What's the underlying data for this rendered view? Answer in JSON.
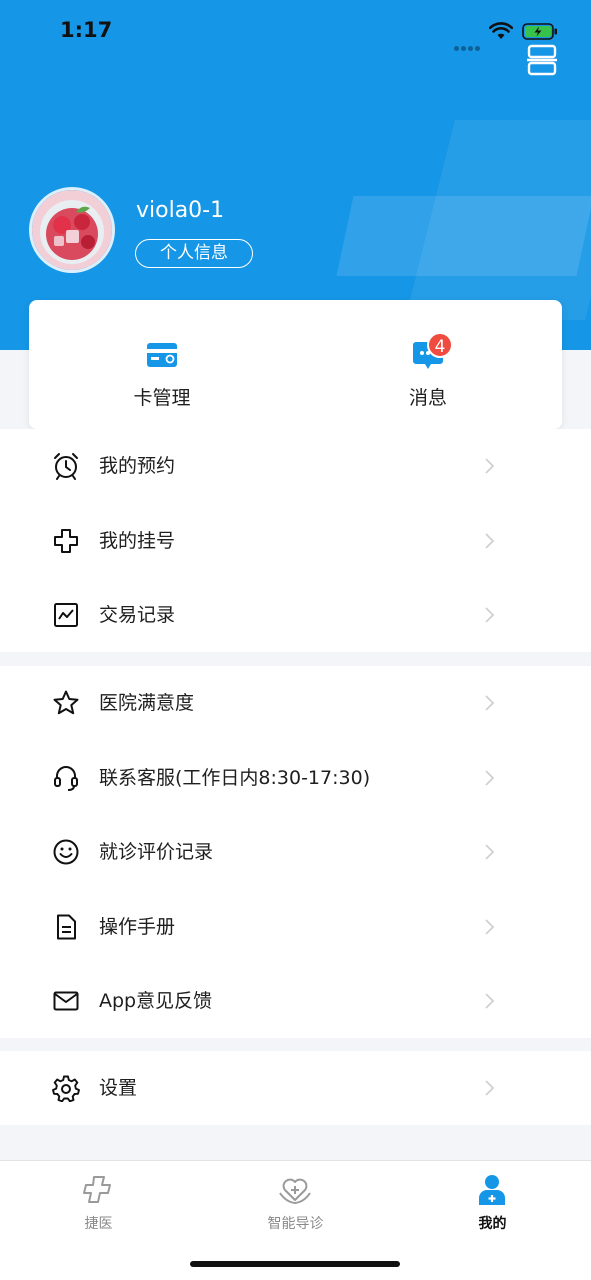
{
  "status_bar": {
    "time": "1:17"
  },
  "profile": {
    "username": "viola0-1",
    "info_button": "个人信息"
  },
  "quick_actions": [
    {
      "label": "卡管理",
      "icon": "card-icon"
    },
    {
      "label": "消息",
      "icon": "message-icon",
      "badge": "4"
    }
  ],
  "menu_group_1": [
    {
      "label": "我的预约",
      "icon": "alarm-clock-icon"
    },
    {
      "label": "我的挂号",
      "icon": "medical-cross-icon"
    },
    {
      "label": "交易记录",
      "icon": "chart-icon"
    }
  ],
  "menu_group_2": [
    {
      "label": "医院满意度",
      "icon": "star-icon"
    },
    {
      "label": "联系客服(工作日内8:30-17:30)",
      "icon": "headset-icon"
    },
    {
      "label": "就诊评价记录",
      "icon": "smiley-icon"
    },
    {
      "label": "操作手册",
      "icon": "document-icon"
    },
    {
      "label": "App意见反馈",
      "icon": "mail-icon"
    }
  ],
  "menu_group_3": [
    {
      "label": "设置",
      "icon": "gear-icon"
    }
  ],
  "tab_bar": [
    {
      "label": "捷医",
      "icon": "cross-outline-icon",
      "active": false
    },
    {
      "label": "智能导诊",
      "icon": "heart-hands-icon",
      "active": false
    },
    {
      "label": "我的",
      "icon": "user-icon",
      "active": true
    }
  ],
  "colors": {
    "primary": "#1596e6",
    "badge": "#ef4b3f",
    "background": "#f3f5f8"
  }
}
